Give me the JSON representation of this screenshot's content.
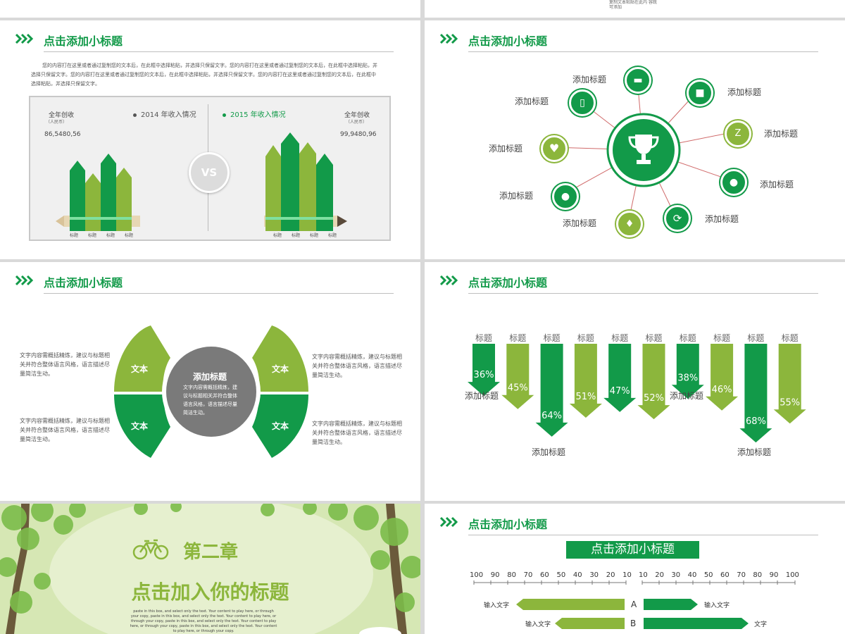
{
  "top_strip": {
    "fragment_text": "复制文本粘贴在此内 容既可添加"
  },
  "common": {
    "subtitle": "点击添加小标题"
  },
  "slide1": {
    "paragraph": "您的内容打在这里或者通过复制您的文本后，在此框中选择粘贴，并选择只保留文字。您的内容打在这里或者通过复制您的文本后，在此框中选择粘贴，并选择只保留文字。您的内容打在这里或者通过复制您的文本后，在此框中选择粘贴，并选择只保留文字。您的内容打在这里或者通过复制您的文本后，在此框中选择粘贴，并选择只保留文字。",
    "legend_2014": "2014 年收入情况",
    "legend_2015": "2015 年收入情况",
    "vs": "VS",
    "left_stat_label": "全年创收",
    "left_stat_unit": "（人民币）",
    "left_stat_value": "86,5480,56",
    "right_stat_label": "全年创收",
    "right_stat_unit": "（人民币）",
    "right_stat_value": "99,9480,96",
    "bar_labels": [
      "标题",
      "标题",
      "标题",
      "标题"
    ],
    "colors": {
      "green": "#129a49",
      "lime": "#8cb63c"
    }
  },
  "slide2": {
    "center_icon": "trophy-icon",
    "items": [
      {
        "label": "添加标题",
        "icon": "graduation-cap-icon"
      },
      {
        "label": "添加标题",
        "icon": "car-icon"
      },
      {
        "label": "添加标题",
        "icon": "bed-icon"
      },
      {
        "label": "添加标题",
        "icon": "apple-icon"
      },
      {
        "label": "添加标题",
        "icon": "refresh-icon"
      },
      {
        "label": "添加标题",
        "icon": "faucet-icon"
      },
      {
        "label": "添加标题",
        "icon": "user-icon"
      },
      {
        "label": "添加标题",
        "icon": "heart-icon"
      },
      {
        "label": "添加标题",
        "icon": "phone-icon"
      }
    ]
  },
  "slide3": {
    "center_title": "添加标题",
    "center_text": "文字内容需概括精炼，建议与标题相关并符合整体语言风格，语言描述尽量简洁生动。",
    "petals": [
      "文本",
      "文本",
      "文本",
      "文本"
    ],
    "side_text": "文字内容需概括精炼，建议与标题相关并符合整体语言风格，语言描述尽量简洁生动。"
  },
  "slide4": {
    "chart_data": {
      "type": "bar",
      "categories": [
        "标题",
        "标题",
        "标题",
        "标题",
        "标题",
        "标题",
        "标题",
        "标题",
        "标题",
        "标题"
      ],
      "values": [
        36,
        45,
        64,
        51,
        47,
        52,
        38,
        46,
        68,
        55
      ],
      "unit": "%",
      "annotations": [
        "添加标题",
        "添加标题",
        "添加标题",
        "添加标题"
      ]
    }
  },
  "slide5": {
    "chapter": "第二章",
    "title": "点击加入你的标题",
    "body": "paste in this box, and select only the text. Your content to play here, or through your copy, paste in this box, and select only the text. Your content to play here, or through your copy, paste in this box, and select only the text. Your content to play here, or through your copy, paste in this box, and select only the text. Your content to play here, or through your copy.",
    "icon": "bicycle-icon"
  },
  "slide6": {
    "banner": "点击添加小标题",
    "axis_left": [
      "100",
      "90",
      "80",
      "70",
      "60",
      "50",
      "40",
      "30",
      "20",
      "10"
    ],
    "axis_right": [
      "10",
      "20",
      "30",
      "40",
      "50",
      "60",
      "70",
      "80",
      "90",
      "100"
    ],
    "rows": [
      {
        "letter": "A",
        "left_label": "输入文字",
        "right_label": "输入文字"
      },
      {
        "letter": "B",
        "left_label": "输入文字",
        "right_label": "文字"
      }
    ]
  }
}
